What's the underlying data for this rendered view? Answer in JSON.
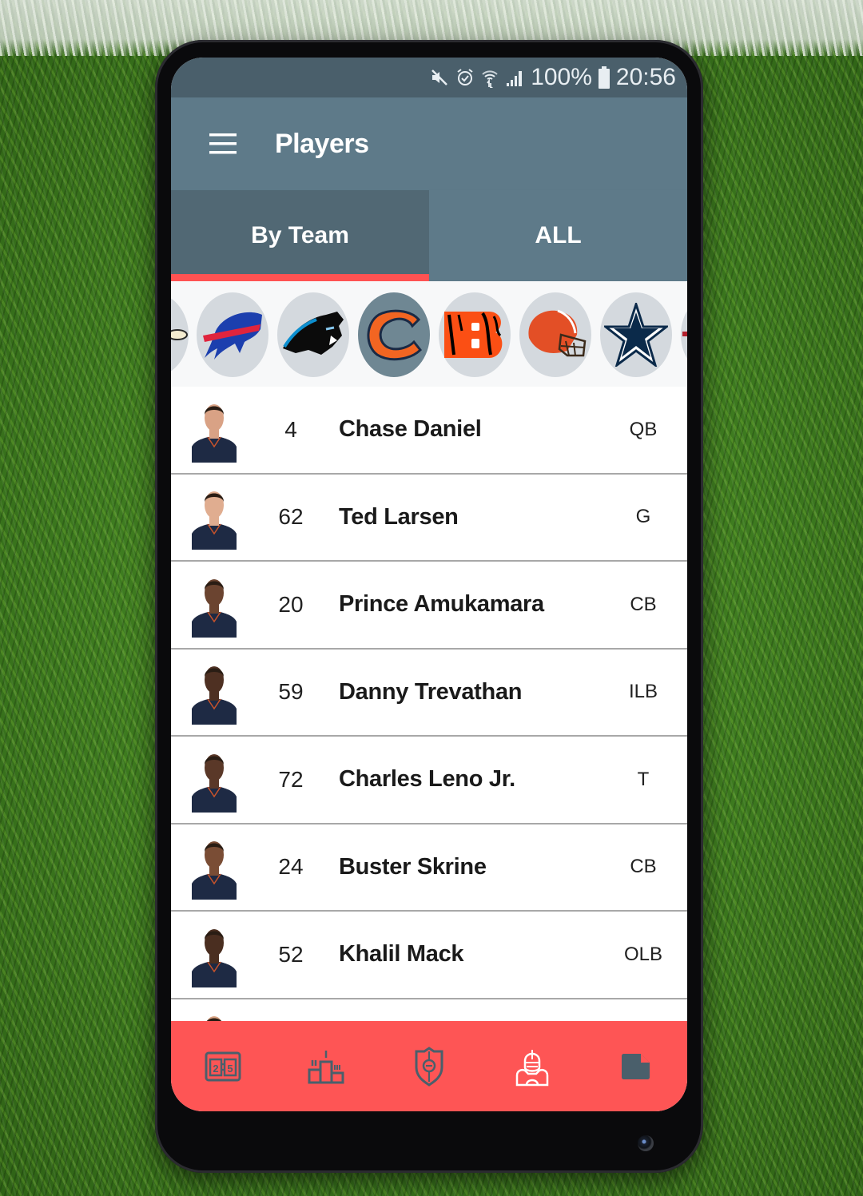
{
  "status_bar": {
    "icons": [
      "mute-icon",
      "alarm-icon",
      "wifi-icon",
      "signal-icon"
    ],
    "battery": "100%",
    "time": "20:56"
  },
  "app_bar": {
    "menu_icon": "hamburger-menu-icon",
    "title": "Players"
  },
  "tabs": [
    {
      "label": "By Team",
      "active": true
    },
    {
      "label": "ALL",
      "active": false
    }
  ],
  "teams": [
    {
      "name": "Bengals-prev (partial)",
      "icon": "partial-team-logo"
    },
    {
      "name": "Bills",
      "icon": "bills-logo"
    },
    {
      "name": "Panthers",
      "icon": "panthers-logo"
    },
    {
      "name": "Bears",
      "icon": "bears-logo",
      "selected": true
    },
    {
      "name": "Bengals",
      "icon": "bengals-logo"
    },
    {
      "name": "Browns",
      "icon": "browns-logo"
    },
    {
      "name": "Cowboys",
      "icon": "cowboys-logo"
    },
    {
      "name": "next (partial)",
      "icon": "partial-team-logo"
    }
  ],
  "players": [
    {
      "number": "4",
      "name": "Chase Daniel",
      "position": "QB"
    },
    {
      "number": "62",
      "name": "Ted Larsen",
      "position": "G"
    },
    {
      "number": "20",
      "name": "Prince Amukamara",
      "position": "CB"
    },
    {
      "number": "59",
      "name": "Danny Trevathan",
      "position": "ILB"
    },
    {
      "number": "72",
      "name": "Charles Leno Jr.",
      "position": "T"
    },
    {
      "number": "24",
      "name": "Buster Skrine",
      "position": "CB"
    },
    {
      "number": "52",
      "name": "Khalil Mack",
      "position": "OLB"
    },
    {
      "number": "",
      "name": "",
      "position": ""
    }
  ],
  "bottom_nav": [
    {
      "icon": "scoreboard-icon",
      "label": "Scores"
    },
    {
      "icon": "podium-icon",
      "label": "Standings"
    },
    {
      "icon": "team-shield-icon",
      "label": "Teams"
    },
    {
      "icon": "football-player-icon",
      "label": "Players",
      "active": true
    },
    {
      "icon": "document-icon",
      "label": "News"
    }
  ],
  "colors": {
    "status_bar": "#4a5f6b",
    "app_bar": "#5e7a89",
    "tab_active": "#516874",
    "accent": "#ff5252",
    "bottom_nav": "#fe5555",
    "nav_icon": "#4a5f6b",
    "nav_icon_active": "#ffffff"
  }
}
